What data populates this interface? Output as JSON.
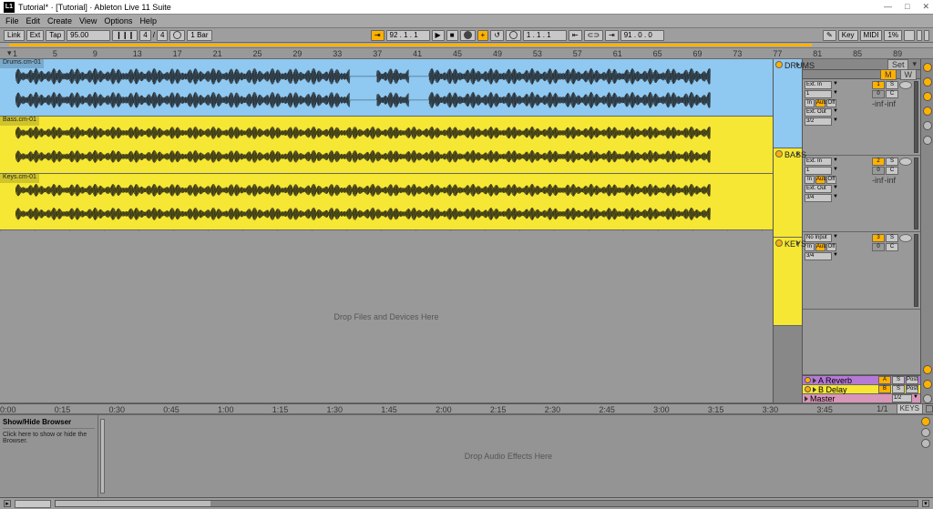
{
  "window": {
    "title": "Tutorial* · [Tutorial] · Ableton Live 11 Suite",
    "icon": "L1"
  },
  "menu": [
    "File",
    "Edit",
    "Create",
    "View",
    "Options",
    "Help"
  ],
  "toolbar": {
    "link": "Link",
    "ext": "Ext",
    "tap": "Tap",
    "tempo": "95.00",
    "sig_top": "4",
    "sig_bot": "4",
    "bar": "1 Bar",
    "pos": "92 . 1 . 1",
    "loop": "1 . 1 . 1",
    "loop_len": "91 . 0 . 0",
    "key": "Key",
    "midi": "MIDI",
    "cpu": "1%"
  },
  "ruler": [
    "1",
    "5",
    "9",
    "13",
    "17",
    "21",
    "25",
    "29",
    "33",
    "37",
    "41",
    "45",
    "49",
    "53",
    "57",
    "61",
    "65",
    "69",
    "73",
    "77",
    "81",
    "85",
    "89"
  ],
  "tracks": [
    {
      "clip": "Drums.cm-01",
      "name": "DRUMS",
      "color": "blue",
      "input": "Ext. In",
      "ch": "1",
      "out": "Ext. Out",
      "outch": "3/2",
      "num": "1",
      "db1": "-inf",
      "db2": "-inf"
    },
    {
      "clip": "Bass.cm-01",
      "name": "BASS",
      "color": "yellow",
      "input": "Ext. In",
      "ch": "1",
      "out": "Ext. Out",
      "outch": "3/4",
      "num": "2",
      "db1": "-inf",
      "db2": "-inf"
    },
    {
      "clip": "Keys.cm-01",
      "name": "KEYS",
      "color": "yellow",
      "input": "No Input",
      "ch": "",
      "out": "",
      "outch": "3/4",
      "num": "3",
      "db1": "",
      "db2": ""
    }
  ],
  "drop_text": "Drop Files and Devices Here",
  "sends": [
    {
      "key": "A",
      "name": "Reverb",
      "cls": "a"
    },
    {
      "key": "B",
      "name": "Delay",
      "cls": "b"
    }
  ],
  "master": {
    "name": "Master",
    "cls": "m",
    "out": "1/2"
  },
  "sends_btn": {
    "s": "S",
    "post": "Post",
    "c": "C"
  },
  "time_ruler": [
    "0:00",
    "0:15",
    "0:30",
    "0:45",
    "1:00",
    "1:15",
    "1:30",
    "1:45",
    "2:00",
    "2:15",
    "2:30",
    "2:45",
    "3:00",
    "3:15",
    "3:30",
    "3:45"
  ],
  "frac": "1/1",
  "info": {
    "header": "Show/Hide Browser",
    "body": "Click here to show or hide the Browser."
  },
  "detail_text": "Drop Audio Effects Here",
  "mixer_hdr": {
    "set": "Set",
    "m": "M",
    "w": "W",
    "io_in": "In",
    "io_auto": "Auto",
    "io_off": "Off"
  },
  "keys_btn": "KEYS"
}
